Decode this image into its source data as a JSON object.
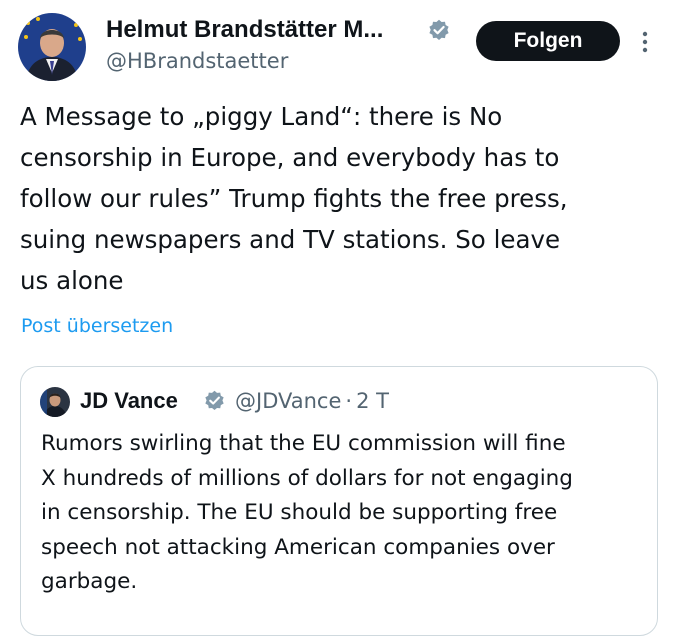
{
  "author": {
    "name": "Helmut Brandstätter M...",
    "handle": "@HBrandstaetter",
    "verified_color": "#829aab"
  },
  "follow_button": {
    "label": "Folgen"
  },
  "menu": {
    "icon": "more-vertical-icon"
  },
  "tweet": {
    "lines": [
      "A Message to „piggy Land“: there is No",
      "censorship in Europe, and everybody has to",
      "follow our rules” Trump fights the free press,",
      "suing newspapers and TV stations. So leave",
      "us alone"
    ]
  },
  "translate": {
    "label": "Post übersetzen"
  },
  "quote": {
    "name": "JD Vance",
    "handle": "@JDVance",
    "separator": "·",
    "time": "2 T",
    "lines": [
      "Rumors swirling that the EU commission will fine",
      "X hundreds of millions of dollars for not engaging",
      "in censorship. The EU should be supporting free",
      "speech not attacking American companies over",
      "garbage."
    ]
  },
  "colors": {
    "text": "#0f1419",
    "secondary": "#536471",
    "link": "#1d9bf0",
    "border": "#cfd9de",
    "button_bg": "#0f1419"
  }
}
